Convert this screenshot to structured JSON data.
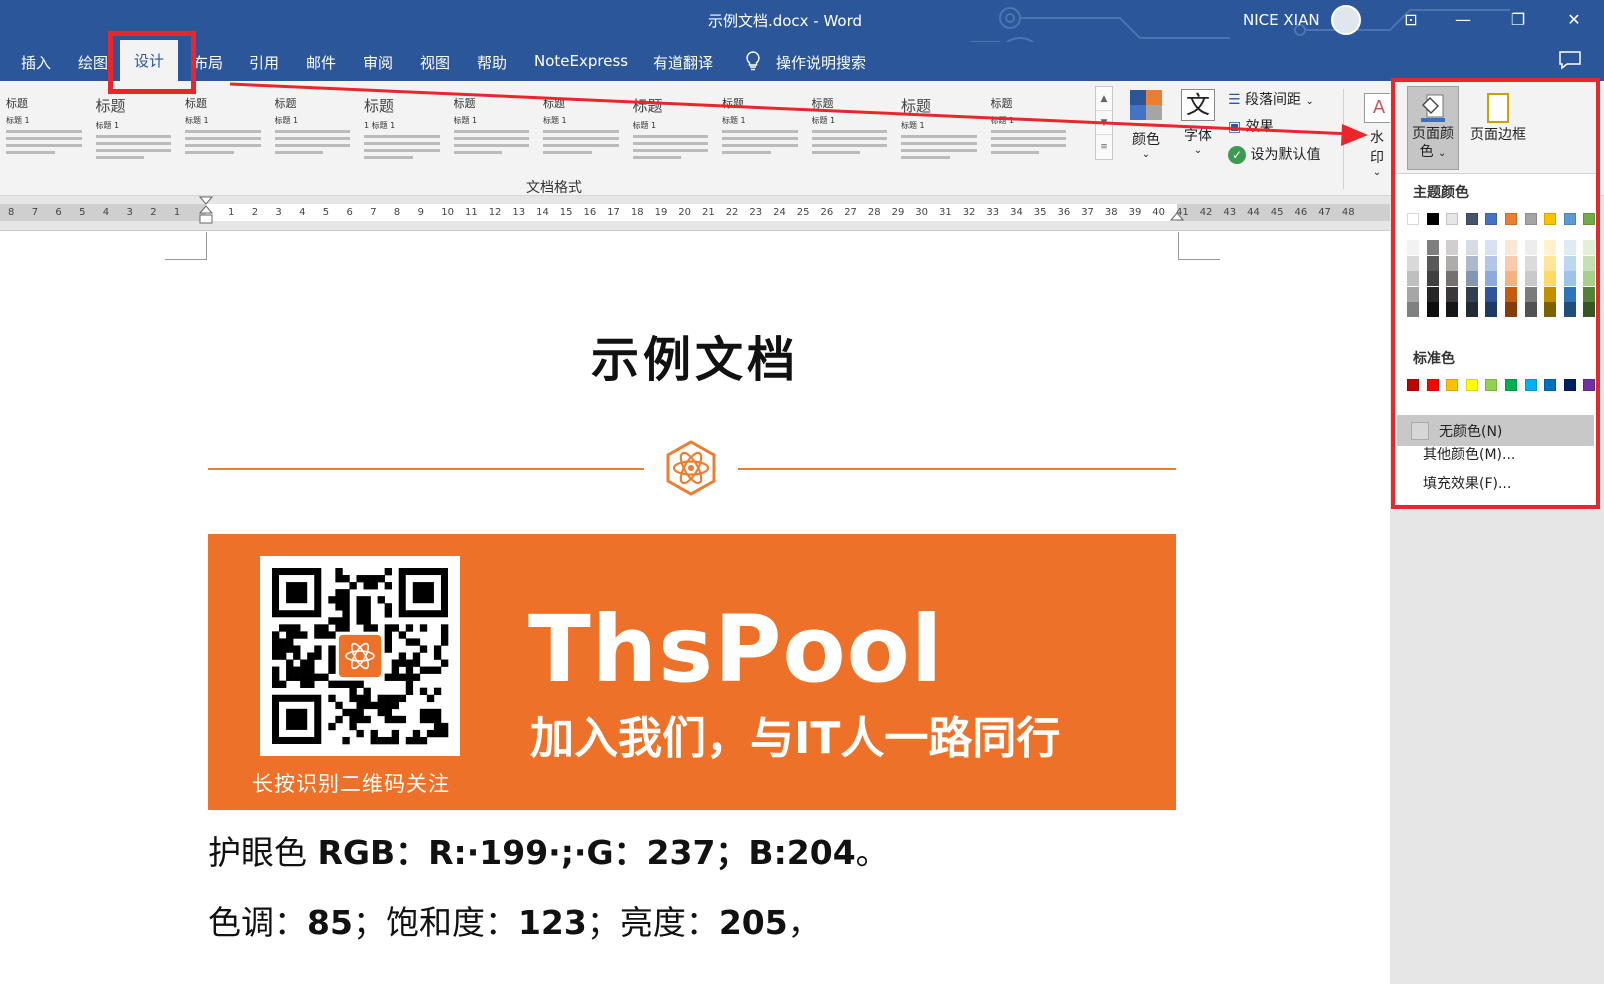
{
  "window": {
    "title": "示例文档.docx  -  Word",
    "user_name": "NICE XIAN",
    "buttons": {
      "ribbon_display": "⊡",
      "minimize": "—",
      "restore": "❐",
      "close": "✕"
    }
  },
  "tabs": [
    {
      "label": "插入"
    },
    {
      "label": "绘图"
    },
    {
      "label": "设计",
      "active": true
    },
    {
      "label": "布局"
    },
    {
      "label": "引用"
    },
    {
      "label": "邮件"
    },
    {
      "label": "审阅"
    },
    {
      "label": "视图"
    },
    {
      "label": "帮助"
    },
    {
      "label": "NoteExpress"
    },
    {
      "label": "有道翻译"
    },
    {
      "label": "操作说明搜索"
    }
  ],
  "ribbon": {
    "gallery_group_label": "文档格式",
    "gallery_items": [
      {
        "title": "标题",
        "line": "标题 1"
      },
      {
        "title": "标题",
        "line": "标题 1"
      },
      {
        "title": "标题",
        "line": "标题 1"
      },
      {
        "title": "标题",
        "line": "标题 1"
      },
      {
        "title": "标题",
        "line": "1  标题 1"
      },
      {
        "title": "标题",
        "line": "标题 1"
      },
      {
        "title": "标题",
        "line": "标题 1"
      },
      {
        "title": "标题",
        "line": "标题 1"
      },
      {
        "title": "标题",
        "line": "标题 1"
      },
      {
        "title": "标题",
        "line": "标题 1"
      },
      {
        "title": "标题",
        "line": "标题 1"
      },
      {
        "title": "标题",
        "line": "标题 1"
      }
    ],
    "colors_label": "颜色",
    "fonts_label": "字体",
    "fonts_glyph": "文",
    "paragraph_spacing_label": "段落间距",
    "effects_label": "效果",
    "set_default_label": "设为默认值",
    "watermark_label": "水印"
  },
  "ruler": {
    "left_numbers": [
      "8",
      "7",
      "6",
      "5",
      "4",
      "3",
      "2",
      "1"
    ],
    "right_numbers": [
      "1",
      "2",
      "3",
      "4",
      "5",
      "6",
      "7",
      "8",
      "9",
      "10",
      "11",
      "12",
      "13",
      "14",
      "15",
      "16",
      "17",
      "18",
      "19",
      "20",
      "21",
      "22",
      "23",
      "24",
      "25",
      "26",
      "27",
      "28",
      "29",
      "30",
      "31",
      "32",
      "33",
      "34",
      "35",
      "36",
      "37",
      "38",
      "39",
      "40",
      "41",
      "42",
      "43",
      "44",
      "45",
      "46",
      "47",
      "48"
    ]
  },
  "document": {
    "title": "示例文档",
    "banner": {
      "brand": "ThsPool",
      "slogan": "加入我们，与IT人一路同行",
      "qr_caption": "长按识别二维码关注"
    },
    "paragraphs": [
      {
        "prefix": "护眼色 ",
        "bold": "RGB：R:·199·;·G：237；B:204",
        "suffix": "。"
      },
      {
        "prefix": "色调：",
        "bold": "85",
        "mid1": "；饱和度：",
        "bold2": "123",
        "mid2": "；亮度：",
        "bold3": "205",
        "suffix": "，"
      }
    ]
  },
  "page_color_dropdown": {
    "page_color_label_1": "页面颜",
    "page_color_label_2": "色",
    "page_borders_label": "页面边框",
    "theme_colors_header": "主题颜色",
    "theme_colors": [
      "#ffffff",
      "#000000",
      "#e7e6e6",
      "#44546a",
      "#4472c4",
      "#ed7d31",
      "#a5a5a5",
      "#ffc000",
      "#5b9bd5",
      "#70ad47"
    ],
    "theme_shades": [
      [
        "#f2f2f2",
        "#d9d9d9",
        "#bfbfbf",
        "#a6a6a6",
        "#808080"
      ],
      [
        "#7f7f7f",
        "#595959",
        "#404040",
        "#262626",
        "#0d0d0d"
      ],
      [
        "#d0cece",
        "#aeabab",
        "#757171",
        "#3a3838",
        "#171616"
      ],
      [
        "#d6dce4",
        "#adb9ca",
        "#8497b0",
        "#333f4f",
        "#222a35"
      ],
      [
        "#d9e2f3",
        "#b4c6e7",
        "#8eaadb",
        "#2f5597",
        "#1f3864"
      ],
      [
        "#fbe5d5",
        "#f7cbac",
        "#f4b183",
        "#c55a11",
        "#833c0b"
      ],
      [
        "#ededed",
        "#dbdbdb",
        "#c9c9c9",
        "#7b7b7b",
        "#525252"
      ],
      [
        "#fff2cc",
        "#fee599",
        "#ffd965",
        "#bf9000",
        "#7f6000"
      ],
      [
        "#deebf6",
        "#bdd7ee",
        "#9dc3e6",
        "#2e75b5",
        "#1f4e79"
      ],
      [
        "#e2efd9",
        "#c5e0b3",
        "#a8d08d",
        "#538135",
        "#375623"
      ]
    ],
    "standard_colors_header": "标准色",
    "standard_colors": [
      "#c00000",
      "#ff0000",
      "#ffc000",
      "#ffff00",
      "#92d050",
      "#00b050",
      "#00b0f0",
      "#0070c0",
      "#002060",
      "#7030a0"
    ],
    "no_color": "无颜色(N)",
    "more_colors": "其他颜色(M)...",
    "fill_effects": "填充效果(F)..."
  },
  "colors": {
    "title_bar": "#2b579a",
    "highlight_red": "#e8262c",
    "banner_orange": "#ed7128",
    "accent_orange": "#ed7d31"
  }
}
